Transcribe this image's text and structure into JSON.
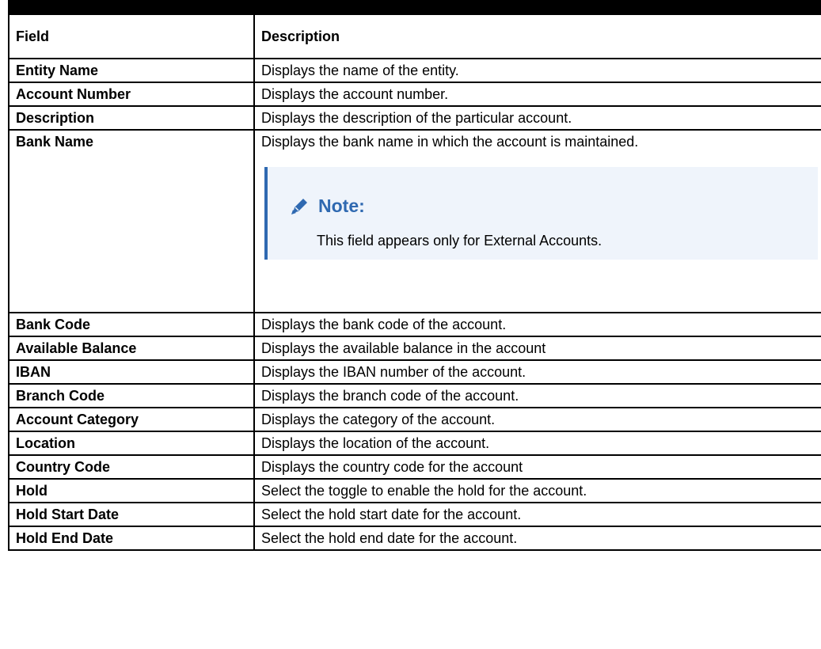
{
  "table": {
    "headers": [
      "Field",
      "Description"
    ],
    "rows": [
      {
        "field": "Entity Name",
        "description": "Displays the name of the entity."
      },
      {
        "field": "Account Number",
        "description": "Displays the account number."
      },
      {
        "field": "Description",
        "description": "Displays the description of the particular account."
      },
      {
        "field": "Bank Name",
        "description": "Displays the bank name in which the account is maintained.",
        "note": {
          "title": "Note:",
          "text": "This field appears only for External Accounts.",
          "icon": "pencil-icon"
        }
      },
      {
        "field": "Bank Code",
        "description": "Displays the bank code of the account."
      },
      {
        "field": "Available Balance",
        "description": "Displays the available balance in the account"
      },
      {
        "field": "IBAN",
        "description": "Displays the IBAN number of the account."
      },
      {
        "field": "Branch Code",
        "description": "Displays the branch code of the account."
      },
      {
        "field": "Account Category",
        "description": "Displays the category of the account."
      },
      {
        "field": "Location",
        "description": "Displays the location of the account."
      },
      {
        "field": "Country Code",
        "description": "Displays the country code for the account"
      },
      {
        "field": "Hold",
        "description": "Select the toggle to enable the hold for the account."
      },
      {
        "field": "Hold Start Date",
        "description": "Select the hold start date for the account."
      },
      {
        "field": "Hold End Date",
        "description": "Select the hold end date for the account."
      }
    ]
  },
  "colors": {
    "note_accent": "#2f69b1",
    "note_background": "#eff4fb"
  }
}
